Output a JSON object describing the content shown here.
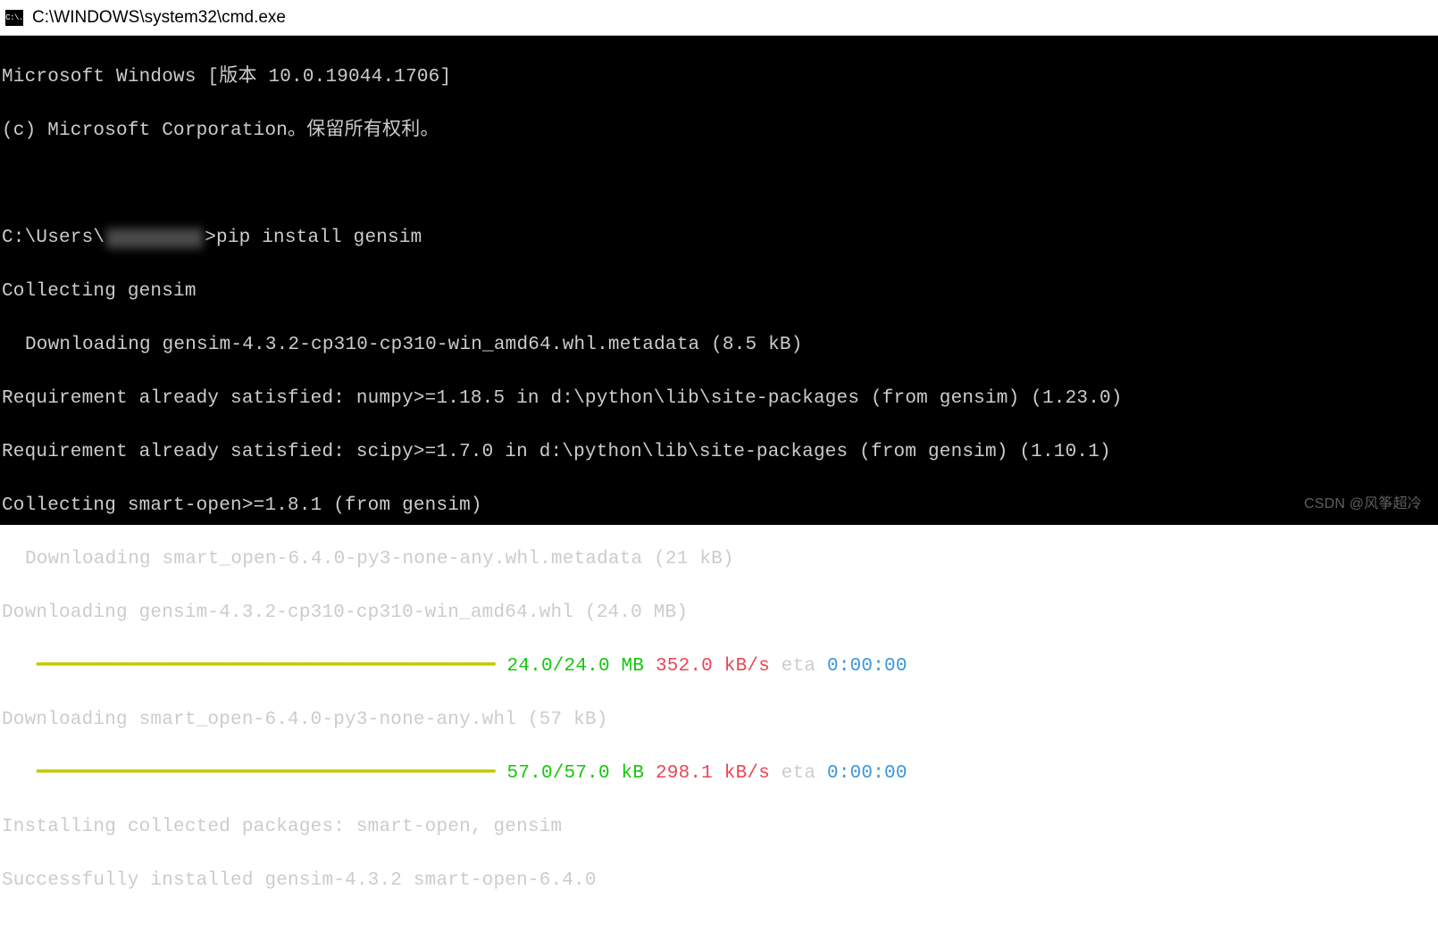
{
  "window": {
    "icon_text": "C:\\.",
    "title": "C:\\WINDOWS\\system32\\cmd.exe"
  },
  "terminal": {
    "header1": "Microsoft Windows [版本 10.0.19044.1706]",
    "header2": "(c) Microsoft Corporation。保留所有权利。",
    "prompt_prefix": "C:\\Users\\",
    "prompt_suffix": ">",
    "command": "pip install gensim",
    "line1": "Collecting gensim",
    "line2": "Downloading gensim-4.3.2-cp310-cp310-win_amd64.whl.metadata (8.5 kB)",
    "line3": "Requirement already satisfied: numpy>=1.18.5 in d:\\python\\lib\\site-packages (from gensim) (1.23.0)",
    "line4": "Requirement already satisfied: scipy>=1.7.0 in d:\\python\\lib\\site-packages (from gensim) (1.10.1)",
    "line5": "Collecting smart-open>=1.8.1 (from gensim)",
    "line6": "Downloading smart_open-6.4.0-py3-none-any.whl.metadata (21 kB)",
    "line7": "Downloading gensim-4.3.2-cp310-cp310-win_amd64.whl (24.0 MB)",
    "progress1": {
      "bar": "━━━━━━━━━━━━━━━━━━━━━━━━━━━━━━━━━━━━━━━━",
      "size": " 24.0/24.0 MB",
      "speed": " 352.0 kB/s",
      "eta_label": " eta",
      "eta_time": " 0:00:00"
    },
    "line8": "Downloading smart_open-6.4.0-py3-none-any.whl (57 kB)",
    "progress2": {
      "bar": "━━━━━━━━━━━━━━━━━━━━━━━━━━━━━━━━━━━━━━━━",
      "size": " 57.0/57.0 kB",
      "speed": " 298.1 kB/s",
      "eta_label": " eta",
      "eta_time": " 0:00:00"
    },
    "line9": "Installing collected packages: smart-open, gensim",
    "line10": "Successfully installed gensim-4.3.2 smart-open-6.4.0"
  },
  "watermark": "CSDN @风筝超冷"
}
